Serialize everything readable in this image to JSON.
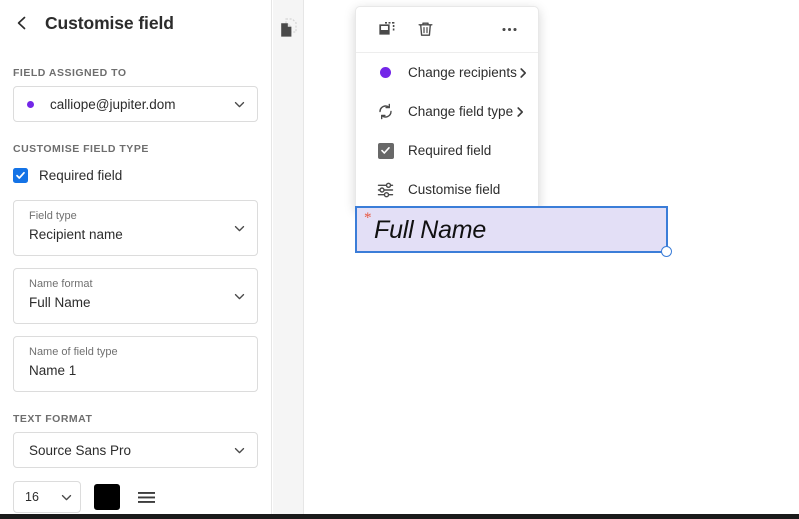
{
  "sidebar": {
    "back_icon": "chevron-left-icon",
    "title": "Customise field",
    "assigned_section_label": "FIELD ASSIGNED TO",
    "assignee": {
      "value": "calliope@jupiter.dom",
      "dot_color": "#7326E8",
      "chevron_icon": "chevron-down-icon"
    },
    "customise_section_label": "CUSTOMISE FIELD TYPE",
    "required_checkbox": {
      "label": "Required field",
      "checked": true,
      "color": "#1473E6"
    },
    "fields": [
      {
        "label": "Field type",
        "value": "Recipient name",
        "has_chevron": true
      },
      {
        "label": "Name format",
        "value": "Full Name",
        "has_chevron": true
      },
      {
        "label": "Name of field type",
        "value": "Name 1",
        "has_chevron": false
      }
    ],
    "text_format_label": "TEXT FORMAT",
    "font_family": "Source Sans Pro",
    "font_size": "16",
    "font_color": "#000000",
    "align_icon": "text-align-icon"
  },
  "rail": {
    "copy_icon": "duplicate-pages-icon"
  },
  "context_menu": {
    "toolbar": [
      {
        "icon": "duplicate-field-icon",
        "name": "duplicate-button"
      },
      {
        "icon": "trash-icon",
        "name": "delete-button"
      },
      {
        "icon": "more-options-icon",
        "name": "more-options-button"
      }
    ],
    "items": [
      {
        "label": "Change recipients",
        "icon": "recipient-dot-icon",
        "has_submenu": true
      },
      {
        "label": "Change field type",
        "icon": "sync-arrows-icon",
        "has_submenu": true
      },
      {
        "label": "Required field",
        "icon": "checkbox-checked-icon",
        "has_submenu": false
      },
      {
        "label": "Customise field",
        "icon": "sliders-icon",
        "has_submenu": false
      }
    ]
  },
  "field_widget": {
    "required_marker": "*",
    "placeholder_text": "Full Name",
    "fill_color": "#E3DFF6",
    "border_color": "#3B7DD8",
    "marker_color": "#E8573F"
  }
}
